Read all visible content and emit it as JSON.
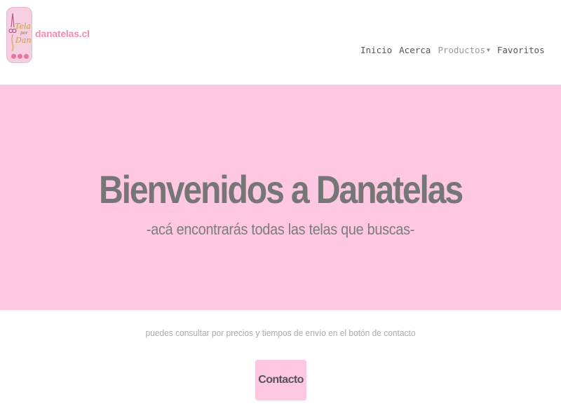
{
  "brand": {
    "name": "danatelas.cl",
    "logo_text": [
      "Tela",
      "por",
      "Dana"
    ],
    "accent_color": "#f48cb3",
    "social_icons": [
      "instagram-icon",
      "facebook-icon",
      "whatsapp-icon"
    ]
  },
  "nav": {
    "items": [
      {
        "label": "Inicio"
      },
      {
        "label": "Acerca"
      },
      {
        "label": "Productos",
        "has_dropdown": true
      },
      {
        "label": "Favoritos"
      }
    ]
  },
  "hero": {
    "title": "Bienvenidos a Danatelas",
    "subtitle": "-acá encontrarás todas las telas que buscas-",
    "background": "#fec8e0"
  },
  "content": {
    "info_text": "puedes consultar por precios y tiempos de envío en el botón de contacto",
    "contact_label": "Contacto"
  }
}
